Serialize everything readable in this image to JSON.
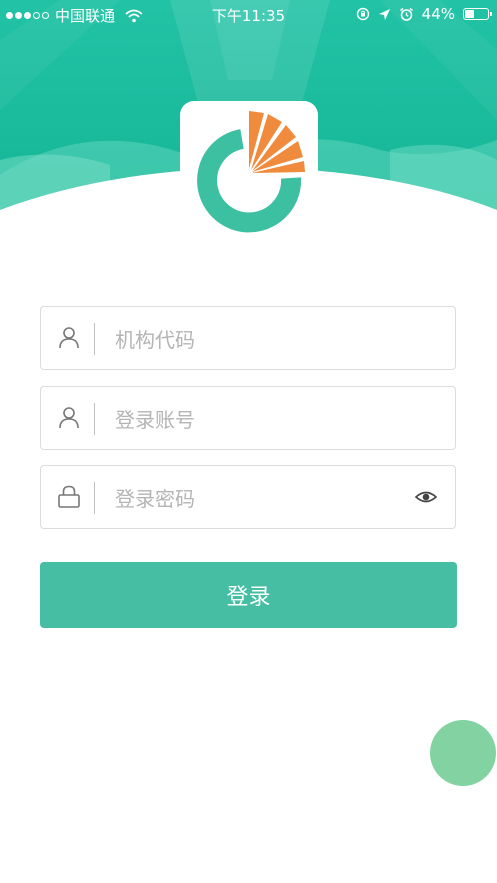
{
  "status_bar": {
    "carrier": "中国联通",
    "time": "下午11:35",
    "battery": "44%",
    "battery_level": 0.44
  },
  "app": {
    "logo_icon": "app-logo-icon",
    "brand_colors": {
      "teal": "#3dbfa2",
      "orange": "#f08a3c"
    }
  },
  "form": {
    "org_code_placeholder": "机构代码",
    "account_placeholder": "登录账号",
    "password_placeholder": "登录密码",
    "login_button": "登录"
  },
  "colors": {
    "header_teal": "#25c1a4",
    "button": "#45bea4",
    "fab": "#82d3a1"
  }
}
